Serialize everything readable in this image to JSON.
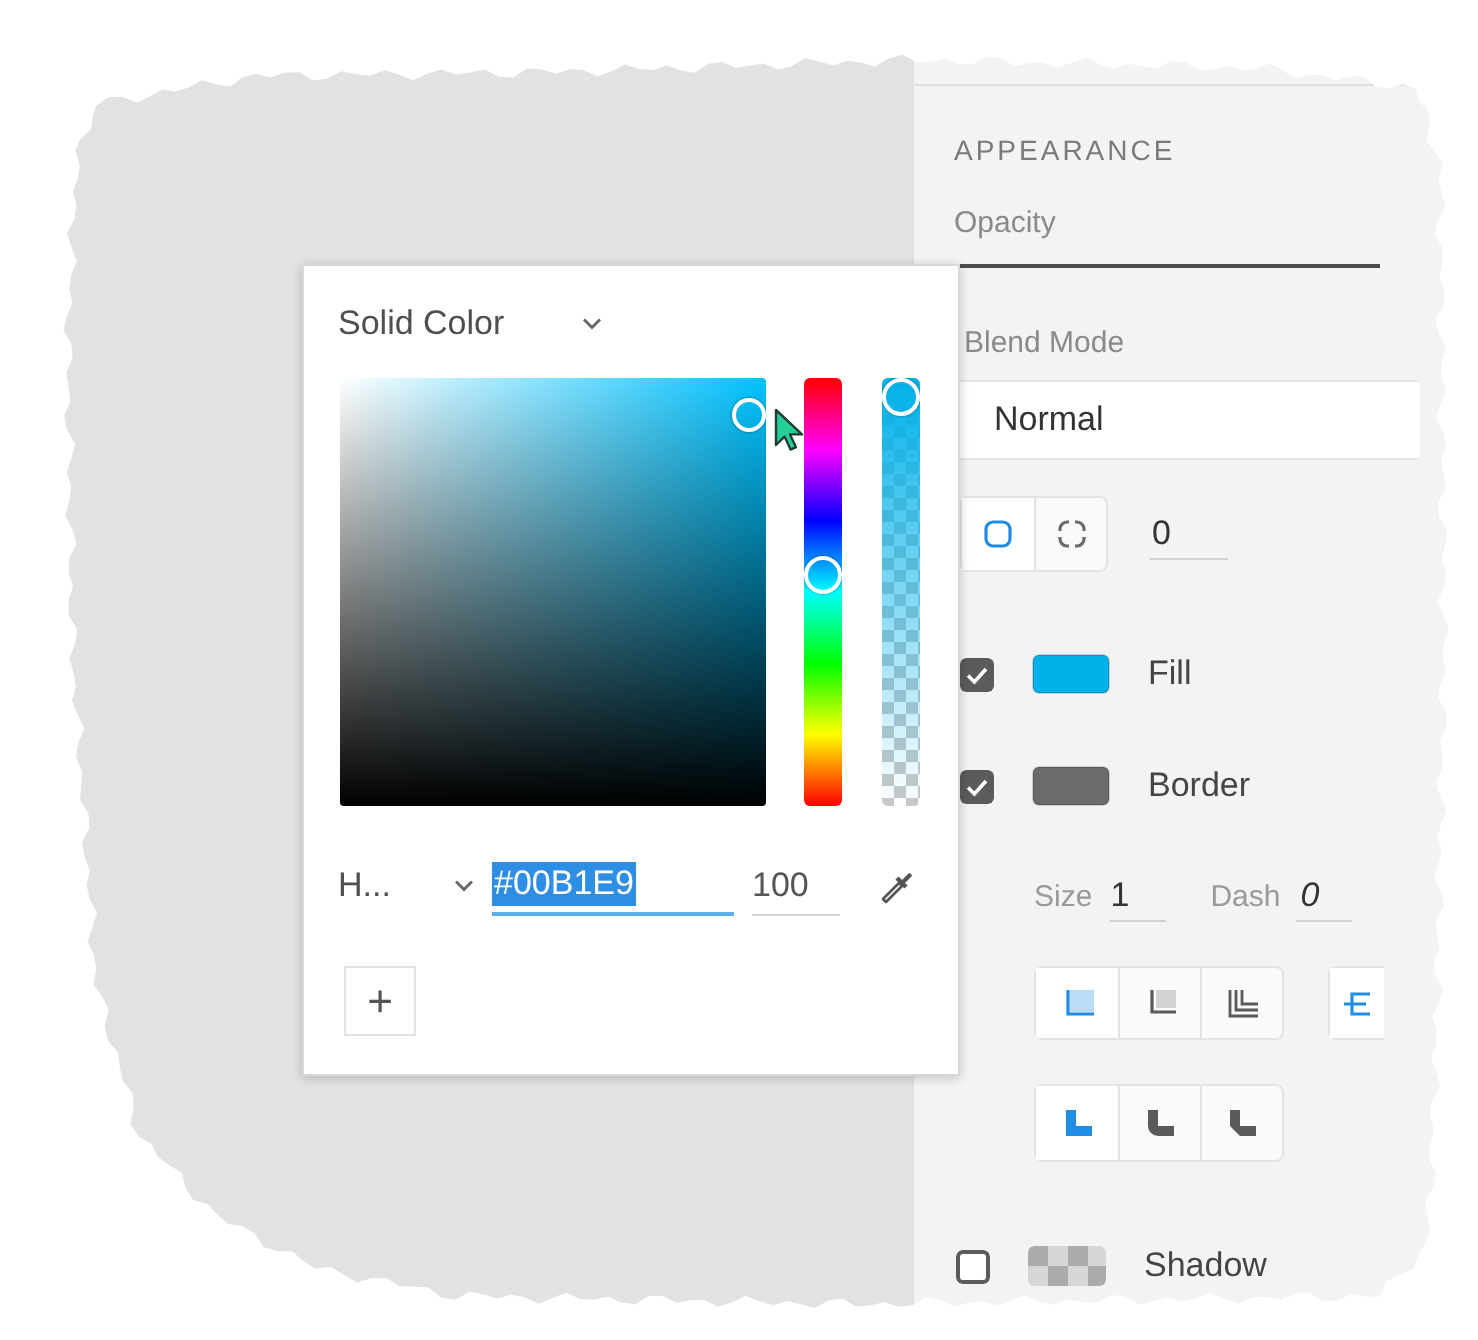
{
  "color_picker": {
    "fill_type": "Solid Color",
    "hue_slider": {
      "level": 0.54
    },
    "alpha_slider": {
      "level": 1
    },
    "color_mode": "H...",
    "hex": {
      "value": "#00B1E9",
      "selected": true
    },
    "opacity_value": "100",
    "add_button": "+"
  },
  "appearance": {
    "heading": "APPEARANCE",
    "opacity": {
      "label": "Opacity"
    },
    "blend_mode": {
      "label": "Blend Mode",
      "value": "Normal"
    },
    "corner_modes": [
      {
        "kind": "uniform",
        "selected": true
      },
      {
        "kind": "per_corner",
        "selected": false
      }
    ],
    "corner_radius": "0",
    "styles": [
      {
        "label": "Fill",
        "checked": true,
        "color": "#00b1e9"
      },
      {
        "label": "Border",
        "checked": true,
        "color": "#6b6b6b"
      }
    ],
    "border": {
      "size_label": "Size",
      "size": "1",
      "dash_label": "Dash",
      "dash": "0"
    },
    "stroke_positions": [
      {
        "kind": "inside",
        "selected": true
      },
      {
        "kind": "center",
        "selected": false
      },
      {
        "kind": "outside",
        "selected": false
      }
    ],
    "cap_styles": [
      {
        "kind": "butt",
        "selected": true
      }
    ],
    "joins": [
      {
        "kind": "miter",
        "selected": true
      },
      {
        "kind": "round",
        "selected": false
      },
      {
        "kind": "bevel",
        "selected": false
      }
    ],
    "shadow": {
      "label": "Shadow",
      "checked": false
    }
  }
}
